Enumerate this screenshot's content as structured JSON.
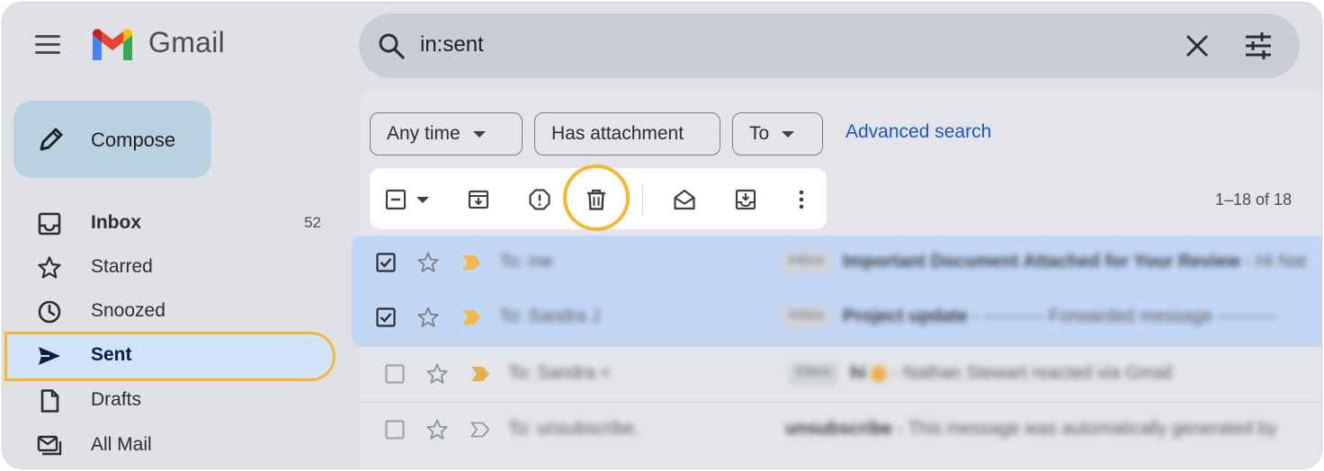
{
  "header": {
    "brand": "Gmail",
    "search_query": "in:sent"
  },
  "sidebar": {
    "compose_label": "Compose",
    "items": [
      {
        "label": "Inbox",
        "count": "52",
        "icon": "inbox-icon"
      },
      {
        "label": "Starred",
        "count": "",
        "icon": "star-icon"
      },
      {
        "label": "Snoozed",
        "count": "",
        "icon": "clock-icon"
      },
      {
        "label": "Sent",
        "count": "",
        "icon": "send-icon"
      },
      {
        "label": "Drafts",
        "count": "",
        "icon": "file-icon"
      },
      {
        "label": "All Mail",
        "count": "",
        "icon": "all-mail-icon"
      }
    ]
  },
  "filters": {
    "any_time": "Any time",
    "has_attachment": "Has attachment",
    "to": "To",
    "advanced_search": "Advanced search"
  },
  "toolbar": {
    "pagination": "1–18 of 18",
    "icons": [
      "select-checkbox-icon",
      "archive-icon",
      "report-spam-icon",
      "delete-icon",
      "mark-read-icon",
      "move-to-inbox-icon",
      "more-vert-icon"
    ]
  },
  "emails": [
    {
      "to": "To: me",
      "badge": "Inbox",
      "subject": "Important Document Attached for Your Review",
      "snippet": "- Hi Nat",
      "selected": true
    },
    {
      "to": "To: Sandra J",
      "badge": "Inbox",
      "subject": "Project update",
      "snippet": "- ---------- Forwarded message ----------",
      "selected": true
    },
    {
      "to": "To: Sandra <",
      "badge": "Inbox",
      "subject": "hi",
      "snippet": "- Nathan Stewart reacted via Gmail",
      "selected": false
    },
    {
      "to": "To: unsubscribe.",
      "badge": "",
      "subject": "unsubscribe",
      "snippet": "- This message was automatically generated by",
      "selected": false
    }
  ],
  "colors": {
    "highlight_ring": "#f5b731",
    "selected_row": "#c2d6f5",
    "link": "#1a57c4",
    "importance_marker": "#f2b84b"
  }
}
